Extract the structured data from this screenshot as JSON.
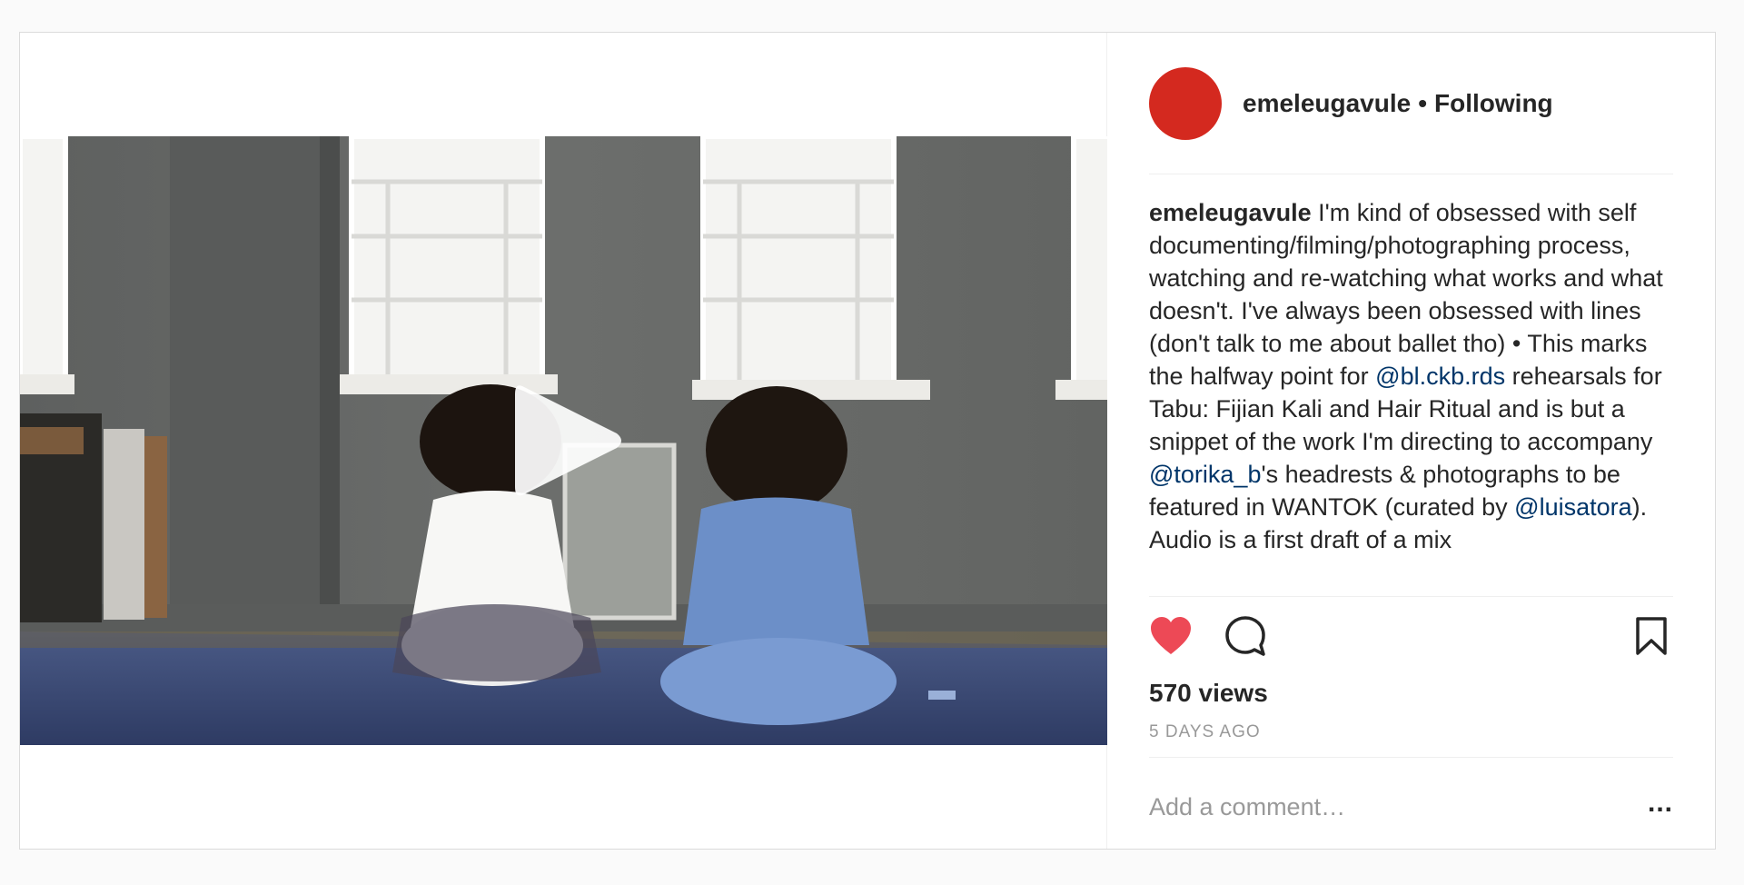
{
  "post": {
    "username": "emeleugavule",
    "separator": "•",
    "follow_status": "Following",
    "avatar_color": "#d4291f",
    "caption": {
      "username": "emeleugavule",
      "segments": [
        {
          "type": "text",
          "text": " I'm kind of obsessed with self documenting/filming/photographing process, watching and re-watching what works and what doesn't. I've always been obsessed with lines (don't talk to me about ballet tho) • This marks the halfway point for "
        },
        {
          "type": "mention",
          "text": "@bl.ckb.rds"
        },
        {
          "type": "text",
          "text": " rehearsals for Tabu: Fijian Kali and Hair Ritual and is but a snippet of the work I'm directing to accompany "
        },
        {
          "type": "mention",
          "text": "@torika_b"
        },
        {
          "type": "text",
          "text": "'s headrests & photographs to be featured in WANTOK (curated by "
        },
        {
          "type": "mention",
          "text": "@luisatora"
        },
        {
          "type": "text",
          "text": "). Audio is a first draft of a mix"
        }
      ]
    },
    "views": "570 views",
    "timestamp": "5 DAYS AGO",
    "comment": {
      "placeholder": "Add a comment…",
      "value": "",
      "more_label": "..."
    },
    "icons": {
      "like": "heart-icon",
      "comment": "comment-bubble-icon",
      "save": "bookmark-icon",
      "play": "play-icon"
    },
    "colors": {
      "like_active": "#ed4956",
      "mention": "#003569",
      "muted": "#999999"
    }
  }
}
